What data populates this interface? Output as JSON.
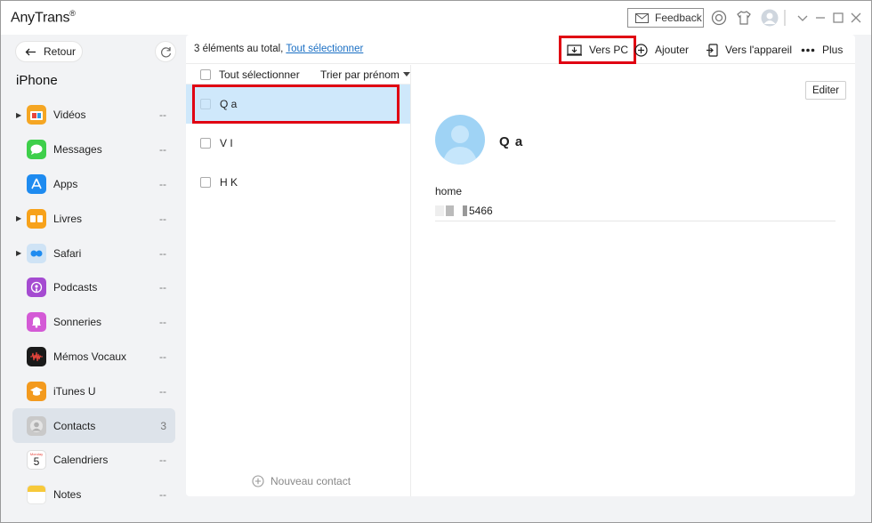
{
  "app": {
    "brand": "AnyTrans",
    "registered": "®"
  },
  "titlebar": {
    "feedback_label": "Feedback"
  },
  "sidebar": {
    "back_label": "Retour",
    "device_name": "iPhone",
    "items": [
      {
        "label": "Vidéos",
        "count": "--",
        "icon": "videos-icon",
        "color": "#f5a623",
        "expandable": true
      },
      {
        "label": "Messages",
        "count": "--",
        "icon": "messages-icon",
        "color": "#3ecf4a",
        "expandable": false
      },
      {
        "label": "Apps",
        "count": "--",
        "icon": "apps-icon",
        "color": "#1e8bf0",
        "expandable": false
      },
      {
        "label": "Livres",
        "count": "--",
        "icon": "books-icon",
        "color": "#f7a21b",
        "expandable": true
      },
      {
        "label": "Safari",
        "count": "--",
        "icon": "safari-icon",
        "color": "#cfe3f5",
        "expandable": true
      },
      {
        "label": "Podcasts",
        "count": "--",
        "icon": "podcasts-icon",
        "color": "#a54bd1",
        "expandable": false
      },
      {
        "label": "Sonneries",
        "count": "--",
        "icon": "ringtones-icon",
        "color": "#d45ad6",
        "expandable": false
      },
      {
        "label": "Mémos Vocaux",
        "count": "--",
        "icon": "voice-memos-icon",
        "color": "#1a1a1a",
        "expandable": false
      },
      {
        "label": "iTunes U",
        "count": "--",
        "icon": "itunes-u-icon",
        "color": "#f39a1e",
        "expandable": false
      },
      {
        "label": "Contacts",
        "count": "3",
        "icon": "contacts-icon",
        "color": "#c9c9c9",
        "expandable": false,
        "active": true
      },
      {
        "label": "Calendriers",
        "count": "--",
        "icon": "calendar-icon",
        "color": "#ffffff",
        "expandable": false,
        "calendar_weekday": "Monday",
        "calendar_day": "5"
      },
      {
        "label": "Notes",
        "count": "--",
        "icon": "notes-icon",
        "color": "#f7c93a",
        "expandable": false
      }
    ]
  },
  "toolbar": {
    "total_text": "3 éléments au total, ",
    "select_all_link": "Tout sélectionner",
    "to_pc": "Vers PC",
    "add": "Ajouter",
    "to_device": "Vers l'appareil",
    "more": "Plus"
  },
  "list": {
    "select_all": "Tout sélectionner",
    "sort": "Trier par prénom",
    "contacts": [
      {
        "name": "Q a",
        "selected": true
      },
      {
        "name": "V I",
        "selected": false
      },
      {
        "name": "H K",
        "selected": false
      }
    ],
    "new_contact": "Nouveau contact"
  },
  "detail": {
    "edit_label": "Editer",
    "name": "Q a",
    "field_label": "home",
    "field_value": "5466"
  },
  "colors": {
    "accent": "#1a6fc4",
    "highlight": "#e00012",
    "selected_row": "#cfe8fb"
  }
}
